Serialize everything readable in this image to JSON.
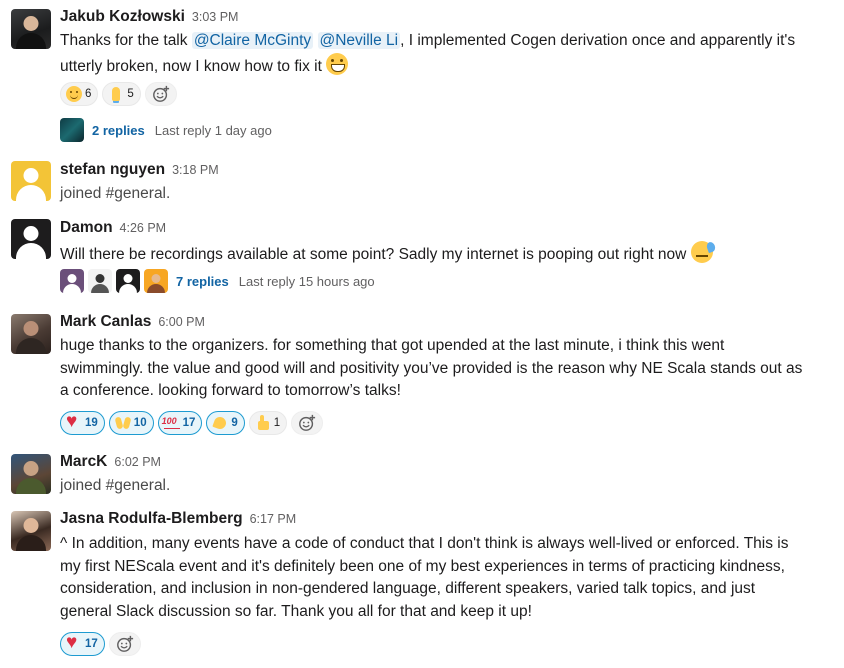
{
  "messages": [
    {
      "author": "Jakub Kozłowski",
      "time": "3:03 PM",
      "text_start": "Thanks for the talk ",
      "mention1": "@Claire McGinty",
      "mention2": "@Neville Li",
      "text_line1_end": ", I implemented Cogen derivation once and apparently it's",
      "text_line2": "utterly broken, now I know how to fix it ",
      "reactions": [
        {
          "emoji": "slightly-smiling-face",
          "count": "6"
        },
        {
          "emoji": "folded-hands",
          "count": "5"
        }
      ],
      "thread": {
        "replies": "2 replies",
        "last_reply": "Last reply 1 day ago"
      }
    },
    {
      "author": "stefan nguyen",
      "time": "3:18 PM",
      "text": "joined #general."
    },
    {
      "author": "Damon",
      "time": "4:26 PM",
      "text": "Will there be recordings available at some point? Sadly my internet is pooping out right now ",
      "thread": {
        "replies": "7 replies",
        "last_reply": "Last reply 15 hours ago"
      }
    },
    {
      "author": "Mark Canlas",
      "time": "6:00 PM",
      "lines": [
        "huge thanks to the organizers. for something that got upended at the last minute, i think this went",
        "swimmingly. the value and good will and positivity you’ve provided is the reason why NE Scala stands out as",
        "a conference. looking forward to tomorrow’s talks!"
      ],
      "reactions": [
        {
          "emoji": "heart",
          "count": "19",
          "active": true
        },
        {
          "emoji": "raised-hands",
          "count": "10",
          "active": true
        },
        {
          "emoji": "100",
          "count": "17",
          "active": true
        },
        {
          "emoji": "clap",
          "count": "9",
          "active": true
        },
        {
          "emoji": "thumbsup",
          "count": "1",
          "active": false
        }
      ]
    },
    {
      "author": "MarcK",
      "time": "6:02 PM",
      "text": "joined #general."
    },
    {
      "author": "Jasna Rodulfa-Blemberg",
      "time": "6:17 PM",
      "lines": [
        "^ In addition, many events have a code of conduct that I don't think is always well-lived or enforced. This is",
        "my first NEScala event and it's definitely been one of my best experiences in terms of practicing kindness,",
        "consideration, and inclusion in non-gendered language, different speakers, varied talk topics, and just",
        "general Slack discussion so far. Thank you all for that and keep it up!"
      ],
      "reactions": [
        {
          "emoji": "heart",
          "count": "17",
          "active": true
        }
      ]
    }
  ],
  "colors": {
    "link": "#1264a3",
    "mention_bg": "#e8f1f8",
    "reaction_active_border": "#1d9bd1",
    "reaction_active_bg": "#e8f5fa"
  }
}
